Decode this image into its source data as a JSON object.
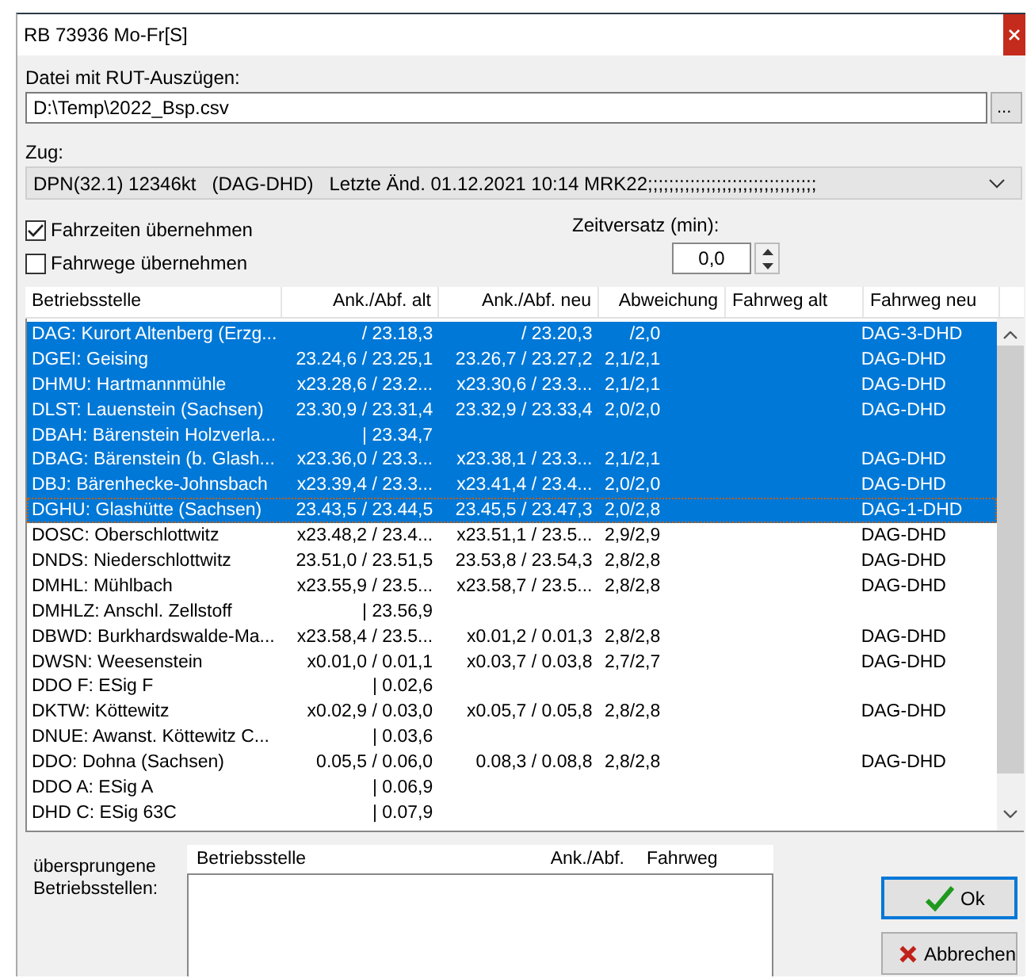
{
  "window": {
    "title": "RB 73936 Mo-Fr[S]"
  },
  "file": {
    "label": "Datei mit RUT-Auszügen:",
    "value": "D:\\Temp\\2022_Bsp.csv",
    "browse": "..."
  },
  "train": {
    "label": "Zug:",
    "value": "DPN(32.1) 12346kt   (DAG-DHD)   Letzte Änd. 01.12.2021 10:14 MRK22;;;;;;;;;;;;;;;;;;;;;;;;;;;;;;;;"
  },
  "options": [
    {
      "label": "Fahrzeiten übernehmen",
      "checked": true
    },
    {
      "label": "Fahrwege übernehmen",
      "checked": false
    }
  ],
  "offset": {
    "label": "Zeitversatz (min):",
    "value": "0,0"
  },
  "table": {
    "columns": [
      "Betriebsstelle",
      "Ank./Abf. alt",
      "Ank./Abf. neu",
      "Abweichung",
      "Fahrweg alt",
      "Fahrweg neu"
    ],
    "rows": [
      {
        "cells": [
          "DAG: Kurort Altenberg (Erzg...",
          "/ 23.18,3",
          "/ 23.20,3",
          "/2,0",
          "",
          "DAG-3-DHD"
        ],
        "selected": true,
        "focused": false
      },
      {
        "cells": [
          "DGEI: Geising",
          "23.24,6 / 23.25,1",
          "23.26,7 / 23.27,2",
          "2,1/2,1",
          "",
          "DAG-DHD"
        ],
        "selected": true,
        "focused": false
      },
      {
        "cells": [
          "DHMU: Hartmannmühle",
          "x23.28,6 / 23.2...",
          "x23.30,6 / 23.3...",
          "2,1/2,1",
          "",
          "DAG-DHD"
        ],
        "selected": true,
        "focused": false
      },
      {
        "cells": [
          "DLST: Lauenstein (Sachsen)",
          "23.30,9 / 23.31,4",
          "23.32,9 / 23.33,4",
          "2,0/2,0",
          "",
          "DAG-DHD"
        ],
        "selected": true,
        "focused": false
      },
      {
        "cells": [
          "DBAH: Bärenstein Holzverla...",
          "| 23.34,7",
          "",
          "",
          "",
          ""
        ],
        "selected": true,
        "focused": false
      },
      {
        "cells": [
          "DBAG: Bärenstein (b. Glash...",
          "x23.36,0 / 23.3...",
          "x23.38,1 / 23.3...",
          "2,1/2,1",
          "",
          "DAG-DHD"
        ],
        "selected": true,
        "focused": false
      },
      {
        "cells": [
          "DBJ: Bärenhecke-Johnsbach",
          "x23.39,4 / 23.3...",
          "x23.41,4 / 23.4...",
          "2,0/2,0",
          "",
          "DAG-DHD"
        ],
        "selected": true,
        "focused": false
      },
      {
        "cells": [
          "DGHU: Glashütte (Sachsen)",
          "23.43,5 / 23.44,5",
          "23.45,5 / 23.47,3",
          "2,0/2,8",
          "",
          "DAG-1-DHD"
        ],
        "selected": true,
        "focused": true
      },
      {
        "cells": [
          "DOSC: Oberschlottwitz",
          "x23.48,2 / 23.4...",
          "x23.51,1 / 23.5...",
          "2,9/2,9",
          "",
          "DAG-DHD"
        ],
        "selected": false,
        "focused": false
      },
      {
        "cells": [
          "DNDS: Niederschlottwitz",
          "23.51,0 / 23.51,5",
          "23.53,8 / 23.54,3",
          "2,8/2,8",
          "",
          "DAG-DHD"
        ],
        "selected": false,
        "focused": false
      },
      {
        "cells": [
          "DMHL: Mühlbach",
          "x23.55,9 / 23.5...",
          "x23.58,7 / 23.5...",
          "2,8/2,8",
          "",
          "DAG-DHD"
        ],
        "selected": false,
        "focused": false
      },
      {
        "cells": [
          "DMHLZ: Anschl. Zellstoff",
          "| 23.56,9",
          "",
          "",
          "",
          ""
        ],
        "selected": false,
        "focused": false
      },
      {
        "cells": [
          "DBWD: Burkhardswalde-Ma...",
          "x23.58,4 / 23.5...",
          "x0.01,2 / 0.01,3",
          "2,8/2,8",
          "",
          "DAG-DHD"
        ],
        "selected": false,
        "focused": false
      },
      {
        "cells": [
          "DWSN: Weesenstein",
          "x0.01,0 / 0.01,1",
          "x0.03,7 / 0.03,8",
          "2,7/2,7",
          "",
          "DAG-DHD"
        ],
        "selected": false,
        "focused": false
      },
      {
        "cells": [
          "DDO F: ESig F",
          "| 0.02,6",
          "",
          "",
          "",
          ""
        ],
        "selected": false,
        "focused": false
      },
      {
        "cells": [
          "DKTW: Köttewitz",
          "x0.02,9 / 0.03,0",
          "x0.05,7 / 0.05,8",
          "2,8/2,8",
          "",
          "DAG-DHD"
        ],
        "selected": false,
        "focused": false
      },
      {
        "cells": [
          "DNUE: Awanst. Köttewitz C...",
          "| 0.03,6",
          "",
          "",
          "",
          ""
        ],
        "selected": false,
        "focused": false
      },
      {
        "cells": [
          "DDO: Dohna (Sachsen)",
          "0.05,5 / 0.06,0",
          "0.08,3 / 0.08,8",
          "2,8/2,8",
          "",
          "DAG-DHD"
        ],
        "selected": false,
        "focused": false
      },
      {
        "cells": [
          "DDO A: ESig A",
          "| 0.06,9",
          "",
          "",
          "",
          ""
        ],
        "selected": false,
        "focused": false
      },
      {
        "cells": [
          "DHD C: ESig 63C",
          "| 0.07,9",
          "",
          "",
          "",
          ""
        ],
        "selected": false,
        "focused": false
      }
    ]
  },
  "skipped": {
    "label": "übersprungene Betriebsstellen:",
    "columns": [
      "Betriebsstelle",
      "Ank./Abf.",
      "Fahrweg"
    ]
  },
  "buttons": [
    {
      "kind": "ok",
      "label": "Ok"
    },
    {
      "kind": "cancel",
      "label": "Abbrechen"
    }
  ]
}
